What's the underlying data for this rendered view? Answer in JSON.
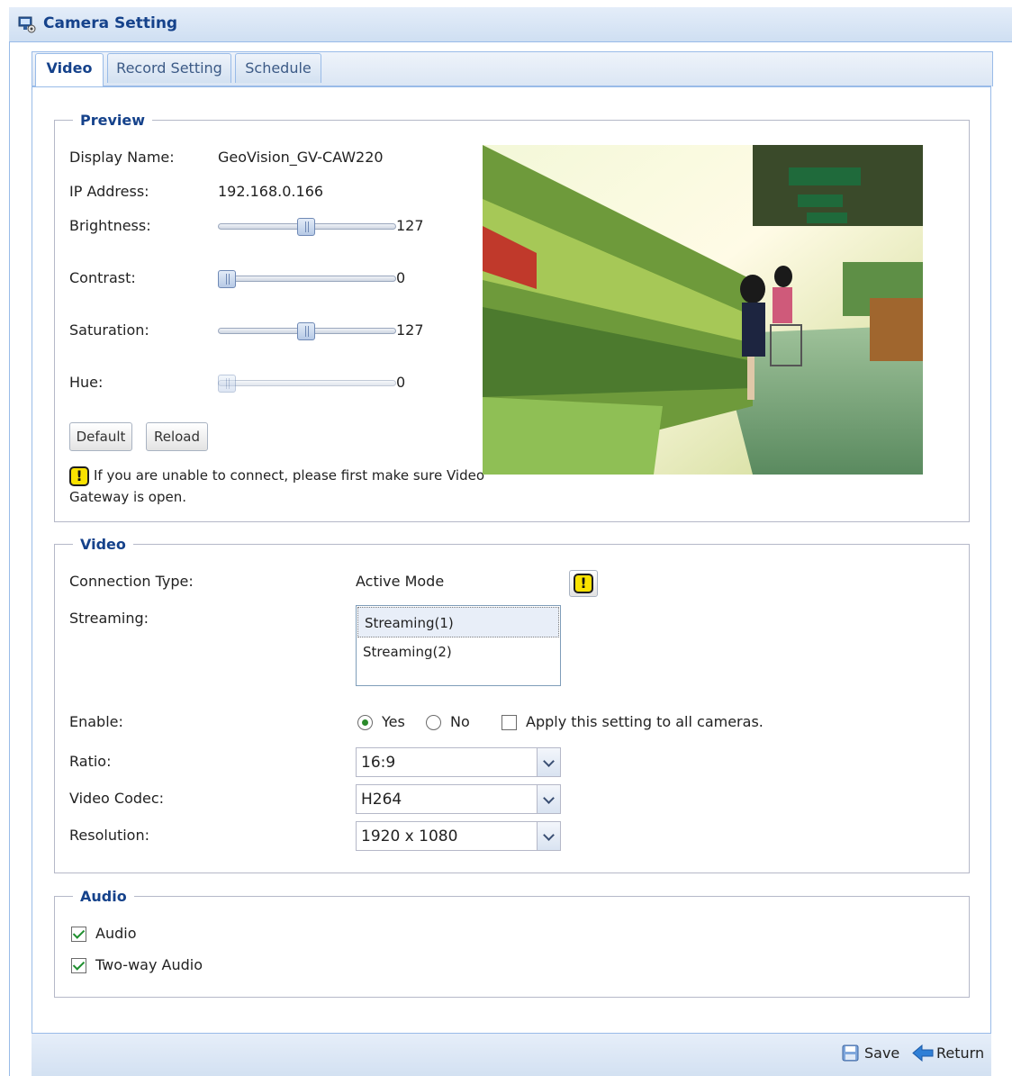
{
  "window": {
    "title": "Camera Setting"
  },
  "tabs": [
    {
      "label": "Video",
      "active": true
    },
    {
      "label": "Record Setting",
      "active": false
    },
    {
      "label": "Schedule",
      "active": false
    }
  ],
  "preview": {
    "legend": "Preview",
    "display_name_label": "Display Name:",
    "display_name_value": "GeoVision_GV-CAW220",
    "ip_label": "IP Address:",
    "ip_value": "192.168.0.166",
    "sliders": [
      {
        "label": "Brightness:",
        "value": "127",
        "fraction": 0.5,
        "disabled": false
      },
      {
        "label": "Contrast:",
        "value": "0",
        "fraction": 0.0,
        "disabled": false
      },
      {
        "label": "Saturation:",
        "value": "127",
        "fraction": 0.5,
        "disabled": false
      },
      {
        "label": "Hue:",
        "value": "0",
        "fraction": 0.0,
        "disabled": true
      }
    ],
    "default_button": "Default",
    "reload_button": "Reload",
    "warning_text_line1": "If you are unable to connect, please first make sure Video",
    "warning_text_line2": "Gateway is open.",
    "warning_icon": "!"
  },
  "video": {
    "legend": "Video",
    "connection_type_label": "Connection Type:",
    "connection_type_value": "Active Mode",
    "streaming_label": "Streaming:",
    "streaming_options": [
      "Streaming(1)",
      "Streaming(2)"
    ],
    "enable_label": "Enable:",
    "enable_yes": "Yes",
    "enable_no": "No",
    "apply_all_label": "Apply this setting to all cameras.",
    "ratio_label": "Ratio:",
    "ratio_value": "16:9",
    "codec_label": "Video Codec:",
    "codec_value": "H264",
    "resolution_label": "Resolution:",
    "resolution_value": "1920 x 1080"
  },
  "audio": {
    "legend": "Audio",
    "audio_label": "Audio",
    "two_way_label": "Two-way Audio"
  },
  "footer": {
    "save_label": "Save",
    "return_label": "Return"
  },
  "colors": {
    "accent": "#15428b",
    "border": "#99bbe8",
    "warning": "#f9e200"
  }
}
